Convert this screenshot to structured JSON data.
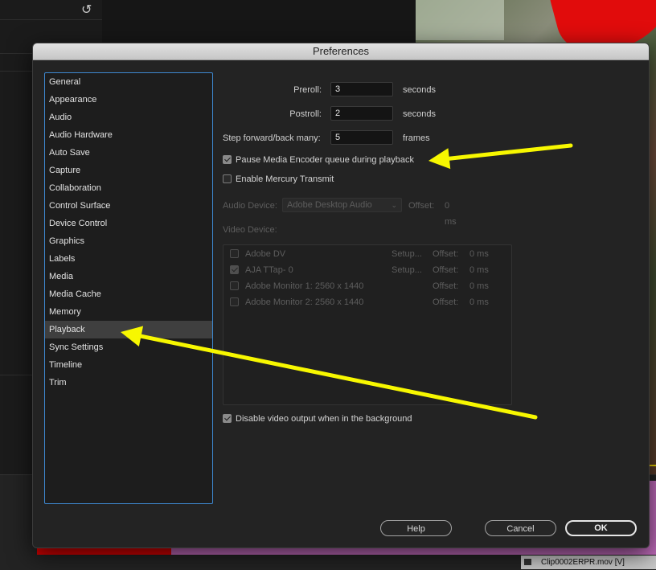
{
  "dialog": {
    "title": "Preferences"
  },
  "sidebar": {
    "items": [
      "General",
      "Appearance",
      "Audio",
      "Audio Hardware",
      "Auto Save",
      "Capture",
      "Collaboration",
      "Control Surface",
      "Device Control",
      "Graphics",
      "Labels",
      "Media",
      "Media Cache",
      "Memory",
      "Playback",
      "Sync Settings",
      "Timeline",
      "Trim"
    ],
    "selected": "Playback"
  },
  "playback": {
    "preroll": {
      "label": "Preroll:",
      "value": "3",
      "unit": "seconds"
    },
    "postroll": {
      "label": "Postroll:",
      "value": "2",
      "unit": "seconds"
    },
    "step": {
      "label": "Step forward/back many:",
      "value": "5",
      "unit": "frames"
    },
    "pause_encoder": {
      "label": "Pause Media Encoder queue during playback",
      "checked": true
    },
    "mercury_transmit": {
      "label": "Enable Mercury Transmit",
      "checked": false
    },
    "audio_device": {
      "label": "Audio Device:",
      "value": "Adobe Desktop Audio",
      "offset_label": "Offset:",
      "offset_value": "0 ms"
    },
    "video_device": {
      "label": "Video Device:",
      "devices": [
        {
          "name": "Adobe DV",
          "checked": false,
          "setup": "Setup...",
          "offset_label": "Offset:",
          "offset_value": "0 ms"
        },
        {
          "name": "AJA TTap- 0",
          "checked": true,
          "setup": "Setup...",
          "offset_label": "Offset:",
          "offset_value": "0 ms"
        },
        {
          "name": "Adobe Monitor 1: 2560 x 1440",
          "checked": false,
          "setup": "",
          "offset_label": "Offset:",
          "offset_value": "0 ms"
        },
        {
          "name": "Adobe Monitor 2: 2560 x 1440",
          "checked": false,
          "setup": "",
          "offset_label": "Offset:",
          "offset_value": "0 ms"
        }
      ]
    },
    "disable_video_bg": {
      "label": "Disable video output when in the background",
      "checked": true
    }
  },
  "buttons": {
    "help": "Help",
    "cancel": "Cancel",
    "ok": "OK"
  },
  "background": {
    "clip_label": "Clip0002ERPR.mov [V]",
    "undo_icon": "↺"
  },
  "annotations": {
    "arrow_color": "#f7f700"
  }
}
